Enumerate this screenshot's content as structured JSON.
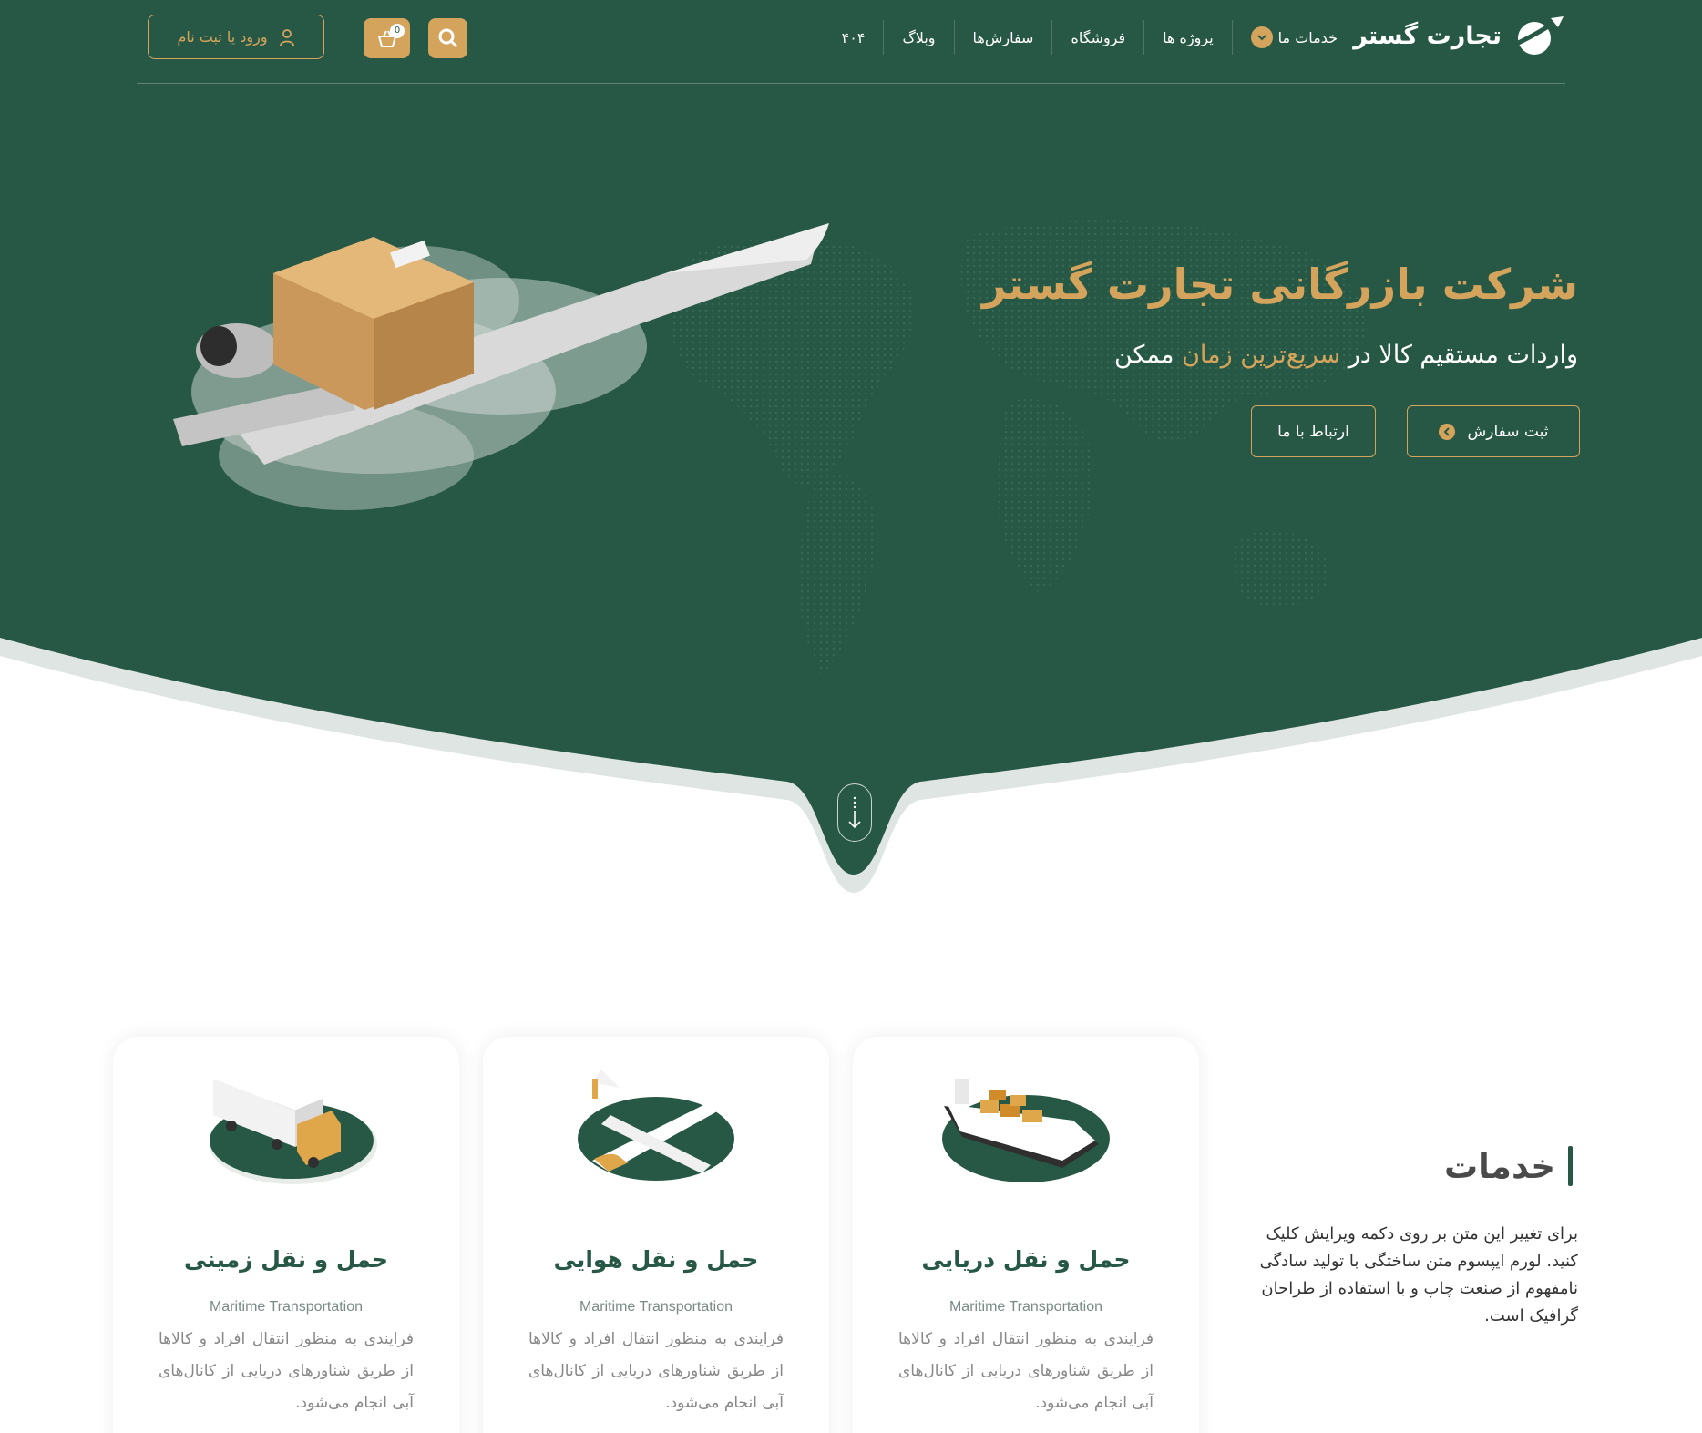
{
  "colors": {
    "hero_green": "#275846",
    "accent_gold": "#d5a45c",
    "white": "#ffffff",
    "heading_gray": "#4a4a4a"
  },
  "header": {
    "logo_text": "تجارت گستر",
    "nav": [
      {
        "label": "خدمات ما",
        "has_dropdown": true
      },
      {
        "label": "پروژه ها"
      },
      {
        "label": "فروشگاه"
      },
      {
        "label": "سفارش‌ها"
      },
      {
        "label": "وبلاگ"
      },
      {
        "label": "۴۰۴"
      }
    ],
    "cart_count": "0",
    "login_label": "ورود یا ثبت نام",
    "icons": {
      "search": "search-icon",
      "cart": "basket-icon",
      "user": "user-icon"
    }
  },
  "hero": {
    "title": "شرکت بازرگانی تجارت گستر",
    "subtitle_prefix": "واردات مستقیم کالا در",
    "subtitle_highlight": "سریع‌ترین زمان",
    "subtitle_suffix": "ممکن",
    "order_button": "ثبت سفارش",
    "contact_button": "ارتباط با ما"
  },
  "services": {
    "heading": "خدمات",
    "description": "برای تغییر این متن بر روی دکمه ویرایش کلیک کنید. لورم ایپسوم متن ساختگی با تولید سادگی نامفهوم از صنعت چاپ و با استفاده از طراحان گرافیک است.",
    "cards": [
      {
        "title": "حمل و نقل دریایی",
        "subtitle": "Maritime Transportation",
        "description": "فرایندی به منظور انتقال افراد و کالاها از طریق شناورهای دریایی از کانال‌های آبی انجام می‌شود.",
        "icon": "ship-icon"
      },
      {
        "title": "حمل و نقل هوایی",
        "subtitle": "Maritime Transportation",
        "description": "فرایندی به منظور انتقال افراد و کالاها از طریق شناورهای دریایی از کانال‌های آبی انجام می‌شود.",
        "icon": "airplane-icon"
      },
      {
        "title": "حمل و نقل زمینی",
        "subtitle": "Maritime Transportation",
        "description": "فرایندی به منظور انتقال افراد و کالاها از طریق شناورهای دریایی از کانال‌های آبی انجام می‌شود.",
        "icon": "truck-icon"
      }
    ]
  }
}
